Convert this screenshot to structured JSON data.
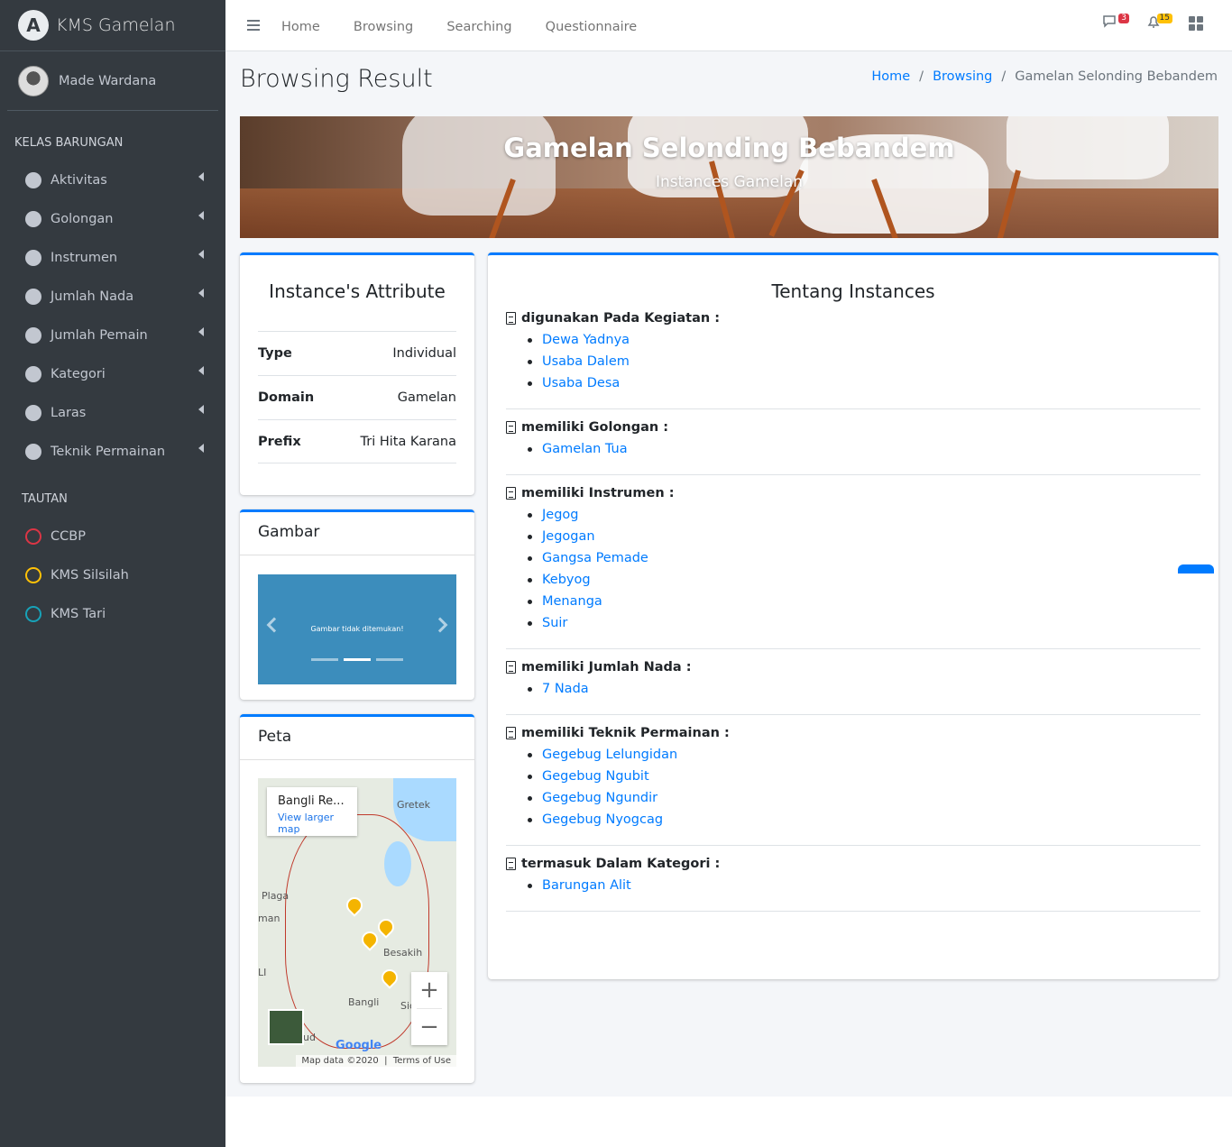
{
  "brand": {
    "logo_letter": "A",
    "name": "KMS Gamelan"
  },
  "user": {
    "name": "Made Wardana"
  },
  "sidebar": {
    "section_label": "KELAS BARUNGAN",
    "items": [
      {
        "label": "Aktivitas"
      },
      {
        "label": "Golongan"
      },
      {
        "label": "Instrumen"
      },
      {
        "label": "Jumlah Nada"
      },
      {
        "label": "Jumlah Pemain"
      },
      {
        "label": "Kategori"
      },
      {
        "label": "Laras"
      },
      {
        "label": "Teknik Permainan"
      }
    ],
    "links_label": "TAUTAN",
    "links": [
      {
        "label": "CCBP",
        "color": "#dc3545"
      },
      {
        "label": "KMS Silsilah",
        "color": "#ffc107"
      },
      {
        "label": "KMS Tari",
        "color": "#17a2b8"
      }
    ]
  },
  "topnav": {
    "links": [
      "Home",
      "Browsing",
      "Searching",
      "Questionnaire"
    ],
    "messages_count": "3",
    "notifications_count": "15"
  },
  "page": {
    "title": "Browsing Result",
    "breadcrumb": [
      "Home",
      "Browsing",
      "Gamelan Selonding Bebandem"
    ]
  },
  "hero": {
    "title": "Gamelan Selonding Bebandem",
    "subtitle": "Instances Gamelan"
  },
  "attributes": {
    "title": "Instance's Attribute",
    "rows": [
      {
        "key": "Type",
        "value": "Individual"
      },
      {
        "key": "Domain",
        "value": "Gamelan"
      },
      {
        "key": "Prefix",
        "value": "Tri Hita Karana"
      }
    ]
  },
  "gallery": {
    "title": "Gambar",
    "caption": "Gambar tidak ditemukan!"
  },
  "map": {
    "title": "Peta",
    "info_title": "Bangli Re...",
    "info_link": "View larger map",
    "labels": [
      "Gretek",
      "Plaga",
      "man",
      "Besakih",
      "Bangli",
      "LI",
      "Sid",
      "ud"
    ],
    "logo": "Google",
    "attribution": "Map data ©2020",
    "terms": "Terms of Use"
  },
  "about": {
    "title": "Tentang Instances",
    "sections": [
      {
        "heading": "digunakan Pada Kegiatan :",
        "items": [
          "Dewa Yadnya",
          "Usaba Dalem",
          "Usaba Desa"
        ]
      },
      {
        "heading": "memiliki Golongan :",
        "items": [
          "Gamelan Tua"
        ]
      },
      {
        "heading": "memiliki Instrumen :",
        "items": [
          "Jegog",
          "Jegogan",
          "Gangsa Pemade",
          "Kebyog",
          "Menanga",
          "Suir"
        ]
      },
      {
        "heading": "memiliki Jumlah Nada :",
        "items": [
          "7 Nada"
        ]
      },
      {
        "heading": "memiliki Teknik Permainan :",
        "items": [
          "Gegebug Lelungidan",
          "Gegebug Ngubit",
          "Gegebug Ngundir",
          "Gegebug Nyogcag"
        ]
      },
      {
        "heading": "termasuk Dalam Kategori :",
        "items": [
          "Barungan Alit"
        ]
      }
    ]
  }
}
